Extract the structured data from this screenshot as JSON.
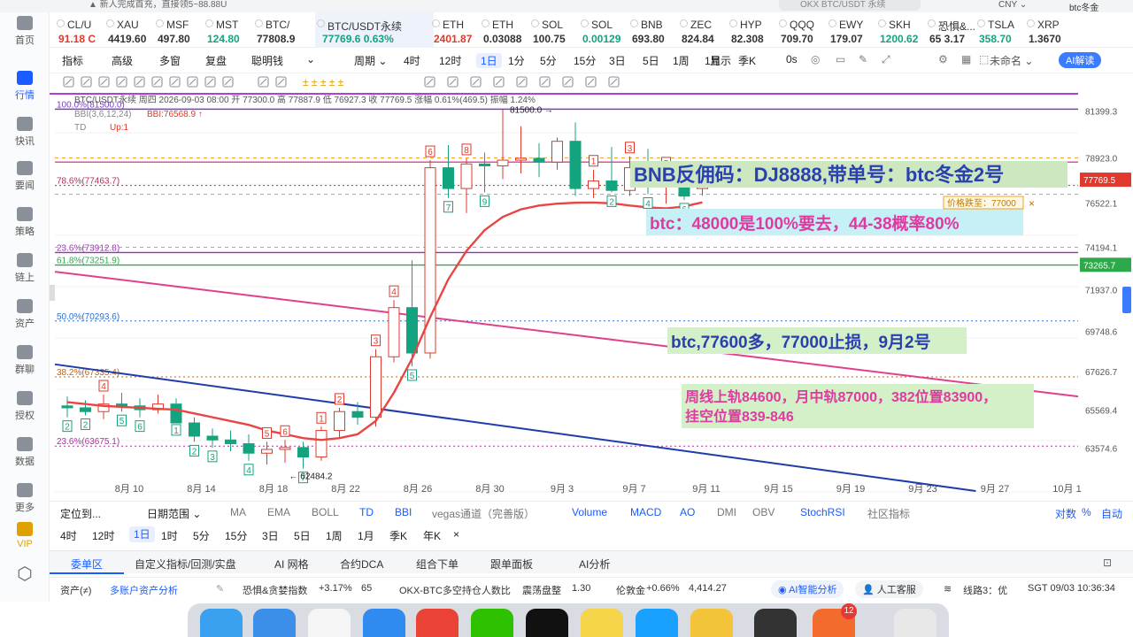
{
  "topstrip": {
    "notice": "▲ 新人完成首充，直接领5~88.88U",
    "search_placeholder": "OKX BTC/USDT 永续",
    "currency": "CNY ⌄",
    "user": "btc冬金"
  },
  "sidebar": {
    "items": [
      {
        "label": "首页",
        "icon": "home-icon"
      },
      {
        "label": "行情",
        "icon": "chart-bars-icon",
        "active": true
      },
      {
        "label": "快讯",
        "icon": "flash-news-icon"
      },
      {
        "label": "要闻",
        "icon": "newspaper-icon"
      },
      {
        "label": "策略",
        "icon": "robot-icon"
      },
      {
        "label": "链上",
        "icon": "chain-link-icon"
      },
      {
        "label": "资产",
        "icon": "wallet-icon"
      },
      {
        "label": "群聊",
        "icon": "chat-icon"
      },
      {
        "label": "授权",
        "icon": "authorize-icon"
      },
      {
        "label": "数据",
        "icon": "data-icon"
      },
      {
        "label": "更多",
        "icon": "more-grid-icon"
      },
      {
        "label": "VIP",
        "icon": "vip-diamond-icon",
        "vip": true
      }
    ]
  },
  "tickers": [
    {
      "sym": "CL/U",
      "px": "91.18 C",
      "dir": "down"
    },
    {
      "sym": "XAU",
      "px": "4419.60",
      "dir": "neutral"
    },
    {
      "sym": "MSF",
      "px": "497.80",
      "dir": "neutral"
    },
    {
      "sym": "MST",
      "px": "124.80",
      "dir": "up"
    },
    {
      "sym": "BTC/",
      "px": "77808.9",
      "dir": "neutral"
    },
    {
      "sym": "BTC/USDT永续",
      "px": "77769.6  0.63%",
      "dir": "up",
      "active": true
    },
    {
      "sym": "ETH",
      "px": "2401.87",
      "dir": "down"
    },
    {
      "sym": "ETH",
      "px": "0.03088",
      "dir": "neutral"
    },
    {
      "sym": "SOL",
      "px": "100.75",
      "dir": "neutral"
    },
    {
      "sym": "SOL",
      "px": "0.00129",
      "dir": "up"
    },
    {
      "sym": "BNB",
      "px": "693.80",
      "dir": "neutral"
    },
    {
      "sym": "ZEC",
      "px": "824.84",
      "dir": "neutral"
    },
    {
      "sym": "HYP",
      "px": "82.308",
      "dir": "neutral"
    },
    {
      "sym": "QQQ",
      "px": "709.70",
      "dir": "neutral"
    },
    {
      "sym": "EWY",
      "px": "179.07",
      "dir": "neutral"
    },
    {
      "sym": "SKH",
      "px": "1200.62",
      "dir": "up"
    },
    {
      "sym": "恐惧&...",
      "px": "65  3.17",
      "dir": "neutral"
    },
    {
      "sym": "TSLA",
      "px": "358.70",
      "dir": "up"
    },
    {
      "sym": "XRP",
      "px": "1.3670",
      "dir": "neutral"
    }
  ],
  "toolbar": {
    "items": [
      "指标",
      "高级",
      "多窗",
      "复盘",
      "聪明钱",
      "⌄",
      "周期 ⌄",
      "4时",
      "12时",
      "1日",
      "1分",
      "5分",
      "15分",
      "3日",
      "5日",
      "1周",
      "1月",
      "季K",
      "0s"
    ],
    "selected": "1日",
    "display": "显示",
    "layout_name": "未命名 ⌄",
    "ai": "AI解读"
  },
  "chart_info": {
    "title_line": "BTC/USDT永续  周四 2026-09-03 08:00  开 77300.0  高 77887.9  低 76927.3  收 77769.5  涨幅 0.61%(469.5)  振幅 1.24%",
    "bbi_line": "BBI(3,6,12,24)",
    "bbi_val": "BBI:76568.9 ↑",
    "td_line": "TD",
    "td_val": "Up:1",
    "fib_100": "100.0%(81500.0)"
  },
  "annotations": {
    "bnb": "BNB反佣码：DJ8888,带单号：btc冬金2号",
    "btc1": "btc：48000是100%要去，44-38概率80%",
    "btc2": "btc,77600多，77000止损，9月2号",
    "week1": "周线上轨84600，月中轨87000，382位置83900，",
    "week2": "挂空位置839-846",
    "price_alert": "价格跌至：77000",
    "high_label": "81500.0 →",
    "low_label": "← 62484.2"
  },
  "chart_data": {
    "type": "candlestick",
    "title": "BTC/USDT永续",
    "x_dates": [
      "8月10",
      "8月14",
      "8月18",
      "8月22",
      "8月26",
      "8月30",
      "9月3",
      "9月7",
      "9月11",
      "9月15",
      "9月19",
      "9月23",
      "9月27",
      "10月1"
    ],
    "x_tick_labels": [
      "8月 10",
      "8月 14",
      "8月 18",
      "8月 22",
      "8月 26",
      "8月 30",
      "9月 3",
      "9月 7",
      "9月 11",
      "9月 15",
      "9月 19",
      "9月 23",
      "9月 27",
      "10月 1"
    ],
    "y_tick_labels": [
      "81399.3",
      "78923.0",
      "76522.1",
      "74194.1",
      "71937.0",
      "69748.6",
      "67626.7",
      "65569.4",
      "63574.6"
    ],
    "ylim": [
      62000,
      82500
    ],
    "last_price": 77769.5,
    "last_price_label": "77769.5",
    "fib_price_label": "73265.7",
    "candles": [
      {
        "o": 65800,
        "h": 66300,
        "l": 65200,
        "c": 65700
      },
      {
        "o": 65700,
        "h": 66100,
        "l": 65300,
        "c": 65500
      },
      {
        "o": 65500,
        "h": 66400,
        "l": 65100,
        "c": 65900
      },
      {
        "o": 65900,
        "h": 66500,
        "l": 65500,
        "c": 65800
      },
      {
        "o": 65800,
        "h": 66200,
        "l": 65200,
        "c": 65600
      },
      {
        "o": 65600,
        "h": 66400,
        "l": 65400,
        "c": 65900
      },
      {
        "o": 65900,
        "h": 66200,
        "l": 65000,
        "c": 64900
      },
      {
        "o": 64900,
        "h": 65200,
        "l": 63900,
        "c": 64200
      },
      {
        "o": 64200,
        "h": 64600,
        "l": 63600,
        "c": 64000
      },
      {
        "o": 64000,
        "h": 64500,
        "l": 63400,
        "c": 63800
      },
      {
        "o": 63800,
        "h": 64300,
        "l": 62900,
        "c": 63300
      },
      {
        "o": 63300,
        "h": 63900,
        "l": 62700,
        "c": 63500
      },
      {
        "o": 63500,
        "h": 64000,
        "l": 62800,
        "c": 63600
      },
      {
        "o": 63600,
        "h": 63900,
        "l": 62484,
        "c": 63100
      },
      {
        "o": 63100,
        "h": 64700,
        "l": 62900,
        "c": 64500
      },
      {
        "o": 64500,
        "h": 65700,
        "l": 64100,
        "c": 65500
      },
      {
        "o": 65500,
        "h": 66000,
        "l": 64800,
        "c": 65200
      },
      {
        "o": 65200,
        "h": 68800,
        "l": 64700,
        "c": 68400
      },
      {
        "o": 68400,
        "h": 71400,
        "l": 68100,
        "c": 71000
      },
      {
        "o": 71000,
        "h": 73500,
        "l": 67900,
        "c": 68600
      },
      {
        "o": 68600,
        "h": 78800,
        "l": 68300,
        "c": 78400
      },
      {
        "o": 78400,
        "h": 79600,
        "l": 76800,
        "c": 77300
      },
      {
        "o": 77300,
        "h": 78900,
        "l": 76000,
        "c": 78600
      },
      {
        "o": 78600,
        "h": 79200,
        "l": 77100,
        "c": 78500
      },
      {
        "o": 78500,
        "h": 81500,
        "l": 77800,
        "c": 78800
      },
      {
        "o": 78800,
        "h": 80600,
        "l": 78100,
        "c": 78900
      },
      {
        "o": 78900,
        "h": 79700,
        "l": 77900,
        "c": 78700
      },
      {
        "o": 78700,
        "h": 80000,
        "l": 78300,
        "c": 79800
      },
      {
        "o": 79800,
        "h": 80800,
        "l": 76900,
        "c": 77300
      },
      {
        "o": 77300,
        "h": 78300,
        "l": 76800,
        "c": 77700
      },
      {
        "o": 77700,
        "h": 79500,
        "l": 77100,
        "c": 77200
      },
      {
        "o": 77200,
        "h": 79000,
        "l": 76900,
        "c": 78400
      },
      {
        "o": 78400,
        "h": 79400,
        "l": 77000,
        "c": 77400
      },
      {
        "o": 77400,
        "h": 78200,
        "l": 76500,
        "c": 77600
      },
      {
        "o": 77600,
        "h": 77900,
        "l": 76700,
        "c": 76900
      },
      {
        "o": 77300,
        "h": 77888,
        "l": 76927,
        "c": 77770
      }
    ],
    "bbi": [
      66000,
      65900,
      65800,
      65750,
      65700,
      65650,
      65600,
      65400,
      65200,
      65000,
      64800,
      64500,
      64300,
      64100,
      64000,
      64100,
      64300,
      65000,
      66500,
      68300,
      70500,
      72500,
      74000,
      75100,
      75800,
      76200,
      76400,
      76500,
      76550,
      76560,
      76520,
      76400,
      76300,
      76250,
      76350,
      76569
    ],
    "td_counts": [
      "2",
      "2",
      "4",
      "5",
      "6",
      "",
      "1",
      "2",
      "3",
      "",
      "4",
      "5",
      "6",
      "7",
      "1",
      "2",
      "",
      "3",
      "4",
      "5",
      "6",
      "7",
      "8",
      "9",
      "",
      "",
      "",
      "",
      "",
      "1",
      "2",
      "3",
      "4",
      "5",
      "6",
      "1"
    ],
    "fib_levels": [
      {
        "label": "100.0%(81500.0)",
        "value": 81500,
        "color": "#7a3fc2"
      },
      {
        "label": "78.6%(77463.7)",
        "value": 77464,
        "color": "#b03060"
      },
      {
        "label": "61.8%(73251.9)",
        "value": 73252,
        "color": "#2da84a"
      },
      {
        "label": "23.6%(73912.8)",
        "value": 73913,
        "color": "#9b2fb5"
      },
      {
        "label": "50.0%(70293.6)",
        "value": 70294,
        "color": "#2d6fd6"
      },
      {
        "label": "38.2%(67335.4)",
        "value": 67335,
        "color": "#c06010"
      },
      {
        "label": "23.6%(63675.1)",
        "value": 63675,
        "color": "#b02e9e"
      }
    ],
    "trendlines": [
      {
        "name": "",
        "color": "#e0408a",
        "from": [
          0,
          72900
        ],
        "to": [
          1,
          66300
        ]
      },
      {
        "name": "",
        "color": "#1f3caa",
        "from": [
          0,
          68000
        ],
        "to": [
          0.9,
          61300
        ]
      }
    ]
  },
  "indicators": {
    "left": [
      "定位到...",
      "日期范围 ⌄",
      "MA",
      "EMA",
      "BOLL",
      "TD",
      "BBI",
      "vegas通道（完善版）"
    ],
    "right": [
      "Volume",
      "MACD",
      "AO",
      "DMI",
      "OBV",
      "StochRSI",
      "社区指标"
    ],
    "scale": [
      "对数",
      "%",
      "自动"
    ]
  },
  "periods": [
    "4时",
    "12时",
    "1日",
    "1时",
    "5分",
    "15分",
    "3日",
    "5日",
    "1周",
    "1月",
    "季K",
    "年K",
    "×"
  ],
  "panel_tabs": [
    "委单区",
    "自定义指标/回测/实盘",
    "AI 网格",
    "合约DCA",
    "组合下单",
    "跟单面板",
    "AI分析"
  ],
  "status": {
    "assets": "资产(≠)",
    "multi": "多账户资产分析",
    "fear_label": "恐惧&贪婪指数",
    "fear_chg": "+3.17%",
    "fear_val": "65",
    "okx_label": "OKX-BTC多空持仓人数比",
    "okx_state": "震荡盘整",
    "okx_val": "1.30",
    "gold_label": "伦敦金",
    "gold_chg": "+0.66%",
    "gold_val": "4,414.27",
    "ai_btn": "AI智能分析",
    "cs_btn": "人工客服",
    "line": "线路3：优",
    "time": "SGT  09/03 10:36:34"
  },
  "dock": {
    "badge_count": "12"
  },
  "colors": {
    "up": "#14a37f",
    "down": "#e0382c",
    "accent": "#1a5cff"
  }
}
